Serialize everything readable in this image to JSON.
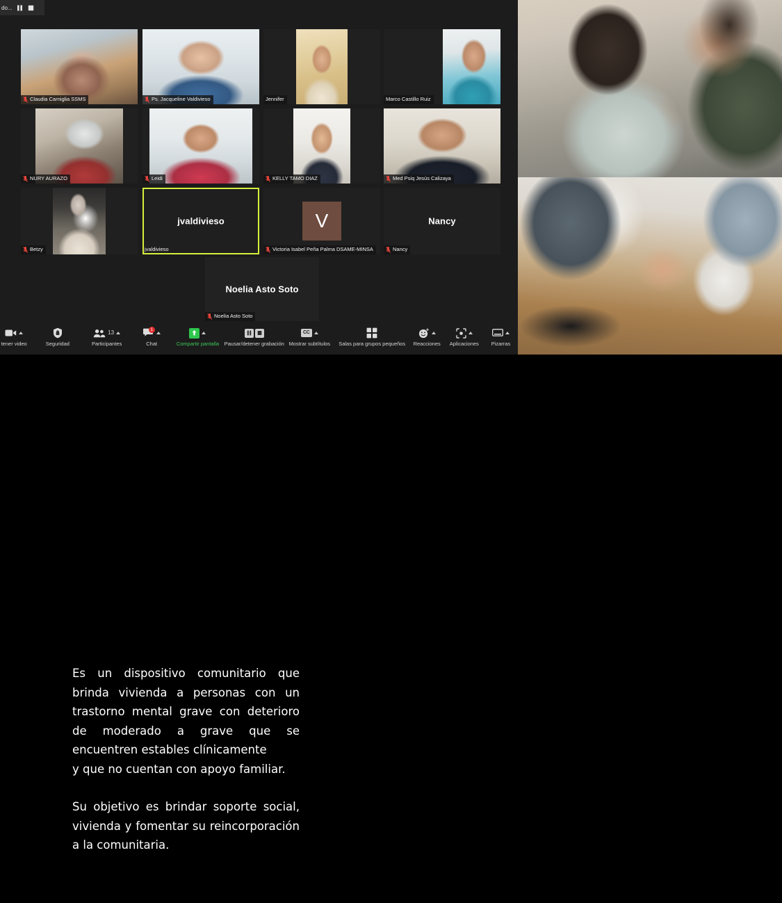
{
  "meeting": {
    "recording_bar": {
      "label": "do...",
      "pause_icon": "pause-icon",
      "stop_icon": "stop-icon"
    },
    "participants": [
      {
        "name": "Claudia Carniglia SSMS",
        "muted": true,
        "video": true,
        "display": "video",
        "active": false
      },
      {
        "name": "Ps. Jacqueline Valdivieso",
        "muted": true,
        "video": true,
        "display": "video",
        "active": false
      },
      {
        "name": "Jennifer",
        "muted": false,
        "video": true,
        "display": "video",
        "active": false
      },
      {
        "name": "Marco Castillo Ruiz",
        "muted": false,
        "video": true,
        "display": "video",
        "active": false
      },
      {
        "name": "NURY AURAZO",
        "muted": true,
        "video": true,
        "display": "video",
        "active": false
      },
      {
        "name": "Leidi",
        "muted": true,
        "video": true,
        "display": "video",
        "active": false
      },
      {
        "name": "KELLY TAMO DIAZ",
        "muted": true,
        "video": true,
        "display": "video",
        "active": false
      },
      {
        "name": "Med Psiq Jesús Calizaya",
        "muted": true,
        "video": true,
        "display": "video",
        "active": false
      },
      {
        "name": "Betzy",
        "muted": true,
        "video": true,
        "display": "video",
        "active": false
      },
      {
        "name": "jvaldivieso",
        "muted": false,
        "video": false,
        "display": "name",
        "big_name": "jvaldivieso",
        "active": true
      },
      {
        "name": "Victoria Isabel Peña Palma DSAME-MINSA",
        "muted": true,
        "video": false,
        "display": "avatar",
        "avatar_initial": "V",
        "active": false
      },
      {
        "name": "Nancy",
        "muted": true,
        "video": false,
        "display": "name",
        "big_name": "Nancy",
        "active": false
      },
      {
        "name": "Noelia Asto Soto",
        "muted": true,
        "video": false,
        "display": "name",
        "big_name": "Noelia Asto Soto",
        "active": false
      }
    ],
    "toolbar": [
      {
        "id": "stop-video",
        "label": "tener video",
        "icon": "camera-icon",
        "caret": true,
        "badge": null,
        "count": null
      },
      {
        "id": "security",
        "label": "Seguridad",
        "icon": "shield-icon",
        "caret": false,
        "badge": null,
        "count": null
      },
      {
        "id": "participants",
        "label": "Participantes",
        "icon": "participants-icon",
        "caret": true,
        "badge": null,
        "count": "13"
      },
      {
        "id": "chat",
        "label": "Chat",
        "icon": "chat-icon",
        "caret": true,
        "badge": "1",
        "count": null
      },
      {
        "id": "share-screen",
        "label": "Compartir pantalla",
        "icon": "share-screen-icon",
        "caret": true,
        "badge": null,
        "count": null
      },
      {
        "id": "recording",
        "label": "Pausar/detener grabación",
        "icon": "pause-stop-icon",
        "caret": false,
        "badge": null,
        "count": null
      },
      {
        "id": "captions",
        "label": "Mostrar subtítulos",
        "icon": "cc-icon",
        "caret": true,
        "badge": null,
        "count": null
      },
      {
        "id": "breakout-rooms",
        "label": "Salas para grupos pequeños",
        "icon": "breakout-rooms-icon",
        "caret": false,
        "badge": null,
        "count": null
      },
      {
        "id": "reactions",
        "label": "Reacciones",
        "icon": "reactions-icon",
        "caret": true,
        "badge": null,
        "count": null
      },
      {
        "id": "apps",
        "label": "Aplicaciones",
        "icon": "apps-icon",
        "caret": true,
        "badge": null,
        "count": null
      },
      {
        "id": "whiteboards",
        "label": "Pizarras",
        "icon": "whiteboard-icon",
        "caret": true,
        "badge": null,
        "count": null
      }
    ],
    "colors": {
      "active_speaker_border": "#d7f03c",
      "share_screen_green": "#3ec95a",
      "badge_red": "#e02d2d",
      "mute_red": "#e8453c",
      "avatar_brown": "#6e4c3f",
      "window_background": "#1c1c1c",
      "page_background": "#000000"
    }
  },
  "photos": [
    {
      "id": "photo-comforting-shoulder",
      "alt": "Hombre abrazando por el hombro a otro hombre"
    },
    {
      "id": "photo-holding-hands",
      "alt": "Dos personas tomadas de la mano sobre una mesa con una taza"
    }
  ],
  "slide": {
    "paragraph1": "Es un dispositivo comunitario que brinda vivienda a personas con un trastorno mental grave con deterioro de moderado a grave que se encuentren estables clínicamente",
    "paragraph1b": " y que no cuentan con apoyo familiar.",
    "paragraph2": "Su objetivo es brindar soporte social, vivienda y fomentar su reincorporación a la comunitaria.",
    "text_color": "#ffffff"
  }
}
